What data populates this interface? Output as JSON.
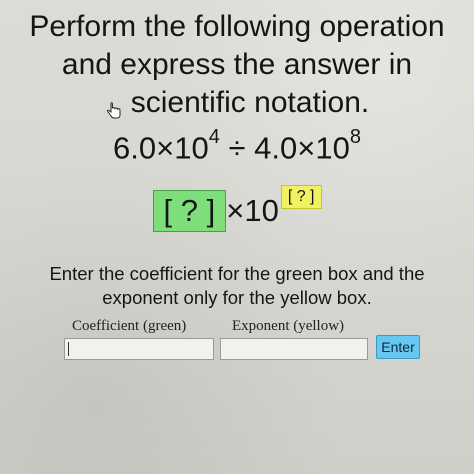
{
  "prompt": {
    "line1": "Perform the following operation",
    "line2": "and express the answer in",
    "line3": "scientific notation."
  },
  "equation": {
    "coef1": "6.0",
    "times": "×",
    "base": "10",
    "exp1": "4",
    "divide": "÷",
    "coef2": "4.0",
    "exp2": "8"
  },
  "answer": {
    "green_box": "?",
    "times_ten": "×10",
    "yellow_box": "?"
  },
  "instructions": {
    "line1": "Enter the coefficient for the green box and the",
    "line2": "exponent only for the yellow box."
  },
  "form": {
    "coefficient_label": "Coefficient (green)",
    "exponent_label": "Exponent (yellow)",
    "coefficient_value": "",
    "exponent_value": "",
    "enter_label": "Enter"
  },
  "colors": {
    "green": "#7dde7a",
    "yellow": "#f1f262",
    "enter_button": "#66c7f0"
  },
  "icons": [
    "hand-pointer-icon"
  ]
}
